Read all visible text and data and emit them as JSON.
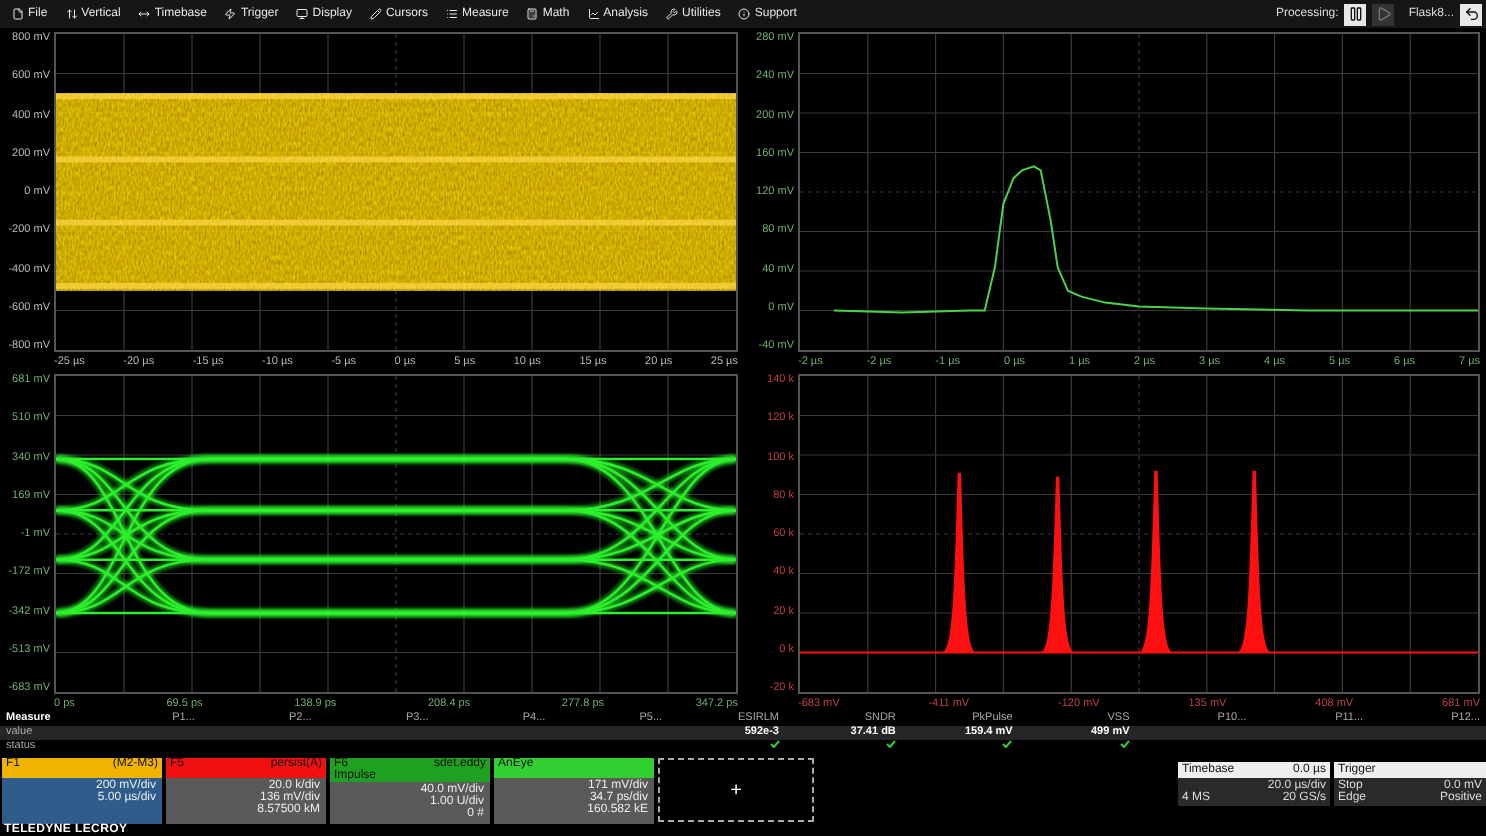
{
  "menu": [
    {
      "label": "File"
    },
    {
      "label": "Vertical"
    },
    {
      "label": "Timebase"
    },
    {
      "label": "Trigger"
    },
    {
      "label": "Display"
    },
    {
      "label": "Cursors"
    },
    {
      "label": "Measure"
    },
    {
      "label": "Math"
    },
    {
      "label": "Analysis"
    },
    {
      "label": "Utilities"
    },
    {
      "label": "Support"
    }
  ],
  "processing": {
    "label": "Processing:",
    "paused": true,
    "profile": "Flask8..."
  },
  "panels": [
    {
      "kind": "noise",
      "color": "#e0b000",
      "y_labels": [
        "800 mV",
        "600 mV",
        "400 mV",
        "200 mV",
        "0 mV",
        "-200 mV",
        "-400 mV",
        "-600 mV",
        "-800 mV"
      ],
      "x_labels": [
        "-25 µs",
        "-20 µs",
        "-15 µs",
        "-10 µs",
        "-5 µs",
        "0 µs",
        "5 µs",
        "10 µs",
        "15 µs",
        "20 µs",
        "25 µs"
      ]
    },
    {
      "kind": "pulse",
      "color": "#4ad24a",
      "y_labels": [
        "280 mV",
        "240 mV",
        "200 mV",
        "160 mV",
        "120 mV",
        "80 mV",
        "40 mV",
        "0 mV",
        "-40 mV"
      ],
      "x_labels": [
        "-2 µs",
        "-2 µs",
        "-1 µs",
        "0 µs",
        "1 µs",
        "2 µs",
        "3 µs",
        "4 µs",
        "5 µs",
        "6 µs",
        "7 µs"
      ]
    },
    {
      "kind": "eye",
      "color": "#2cf02c",
      "y_labels": [
        "681 mV",
        "510 mV",
        "340 mV",
        "169 mV",
        "-1 mV",
        "-172 mV",
        "-342 mV",
        "-513 mV",
        "-683 mV"
      ],
      "x_labels": [
        "0 ps",
        "69.5 ps",
        "138.9 ps",
        "208.4 ps",
        "277.8 ps",
        "347.2 ps"
      ]
    },
    {
      "kind": "histogram",
      "color": "#ff1010",
      "y_labels": [
        "140 k",
        "120 k",
        "100 k",
        "80 k",
        "60 k",
        "40 k",
        "20 k",
        "0 k",
        "-20 k"
      ],
      "x_labels": [
        "-683 mV",
        "-411 mV",
        "-120 mV",
        "135 mV",
        "408 mV",
        "681 mV"
      ]
    }
  ],
  "measure": {
    "title": "Measure",
    "row_labels": [
      "value",
      "status"
    ],
    "params": [
      {
        "name": "P1..."
      },
      {
        "name": "P2..."
      },
      {
        "name": "P3..."
      },
      {
        "name": "P4..."
      },
      {
        "name": "P5..."
      },
      {
        "name": "ESIRLM",
        "value": "592e-3",
        "ok": true
      },
      {
        "name": "SNDR",
        "value": "37.41 dB",
        "ok": true
      },
      {
        "name": "PkPulse",
        "value": "159.4 mV",
        "ok": true
      },
      {
        "name": "VSS",
        "value": "499 mV",
        "ok": true
      },
      {
        "name": "P10..."
      },
      {
        "name": "P11..."
      },
      {
        "name": "P12..."
      }
    ]
  },
  "descriptors": [
    {
      "name": "F1",
      "source": "(M2-M3)",
      "color": "#f0b400",
      "selected": true,
      "lines": [
        "200 mV/div",
        "5.00 µs/div"
      ]
    },
    {
      "name": "F5",
      "source": "persist(A)",
      "color": "#f01010",
      "selected": false,
      "lines": [
        "20.0 k/div",
        "136 mV/div",
        "8.57500 kM"
      ]
    },
    {
      "name": "F6",
      "source": "sdet.eddy",
      "note": "Impulse",
      "color": "#20a020",
      "selected": false,
      "lines": [
        "40.0 mV/div",
        "1.00 U/div",
        "0 #"
      ]
    },
    {
      "name": "AnEye",
      "color": "#30d030",
      "selected": false,
      "lines": [
        "171 mV/div",
        "34.7 ps/div",
        "160.582 kE"
      ]
    }
  ],
  "add_label": "+",
  "timebase": {
    "label": "Timebase",
    "value": "0.0 µs",
    "rows": [
      {
        "value": "20.0 µs/div"
      },
      {
        "key": "4 MS",
        "value": "20 GS/s"
      }
    ]
  },
  "trigger": {
    "label": "Trigger",
    "rows": [
      {
        "key": "Stop",
        "value": "0.0 mV"
      },
      {
        "key": "Edge",
        "value": "Positive"
      }
    ]
  },
  "brand": "TELEDYNE LECROY"
}
